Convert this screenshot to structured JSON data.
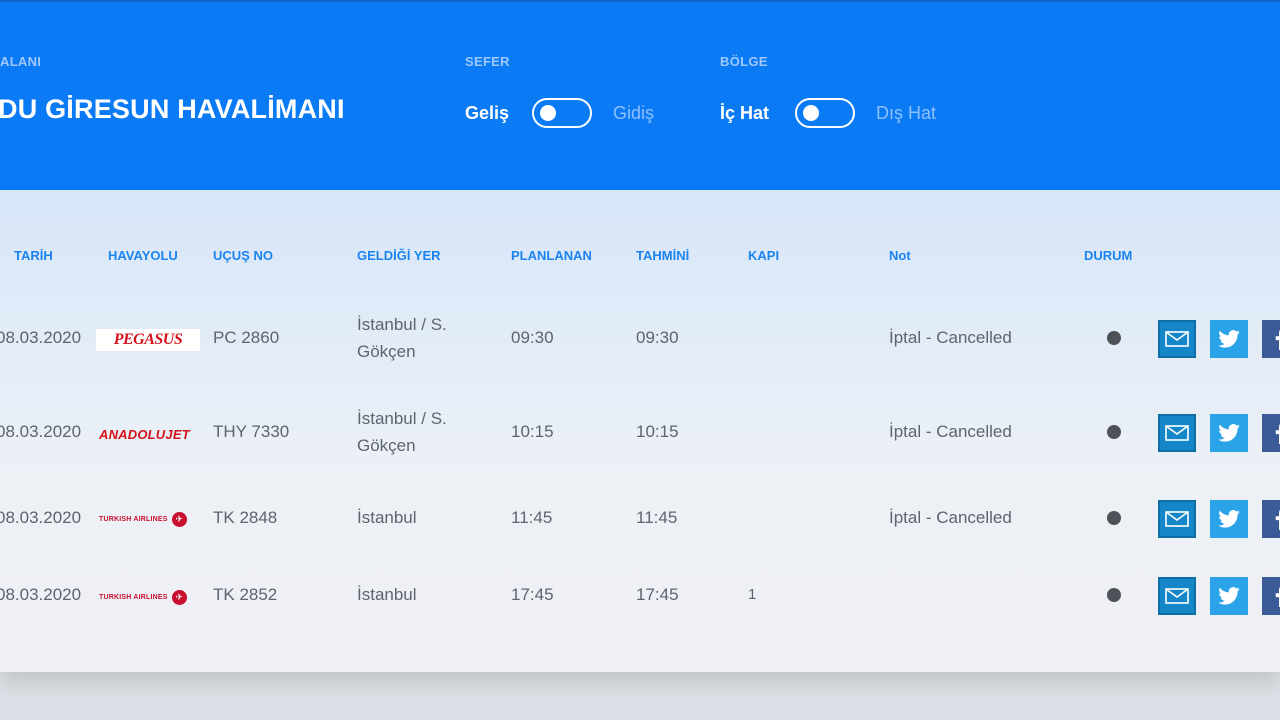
{
  "header": {
    "airport_label": "ALANI",
    "airport_name": "DU GİRESUN HAVALİMANI",
    "sefer_label": "SEFER",
    "sefer_on": "Geliş",
    "sefer_off": "Gidiş",
    "bolge_label": "BÖLGE",
    "bolge_on": "İç Hat",
    "bolge_off": "Dış Hat"
  },
  "table": {
    "columns": {
      "tarih": "TARİH",
      "havayolu": "HAVAYOLU",
      "ucus_no": "UÇUŞ NO",
      "geldigi_yer": "GELDİĞİ YER",
      "planlanan": "PLANLANAN",
      "tahmini": "TAHMİNİ",
      "kapi": "KAPI",
      "not": "Not",
      "durum": "DURUM"
    },
    "rows": [
      {
        "date": "08.03.2020",
        "airline_logo_text": "PEGASUS",
        "flight": "PC 2860",
        "origin_line1": "İstanbul / S.",
        "origin_line2": "Gökçen",
        "planned": "09:30",
        "estimated": "09:30",
        "gate": "",
        "note": "İptal - Cancelled"
      },
      {
        "date": "08.03.2020",
        "airline_logo_text": "ANADOLUJET",
        "flight": "THY 7330",
        "origin_line1": "İstanbul / S.",
        "origin_line2": "Gökçen",
        "planned": "10:15",
        "estimated": "10:15",
        "gate": "",
        "note": "İptal - Cancelled"
      },
      {
        "date": "08.03.2020",
        "airline_logo_text": "TURKISH AIRLINES",
        "flight": "TK 2848",
        "origin_line1": "İstanbul",
        "origin_line2": "",
        "planned": "11:45",
        "estimated": "11:45",
        "gate": "",
        "note": "İptal - Cancelled"
      },
      {
        "date": "08.03.2020",
        "airline_logo_text": "TURKISH AIRLINES",
        "flight": "TK 2852",
        "origin_line1": "İstanbul",
        "origin_line2": "",
        "planned": "17:45",
        "estimated": "17:45",
        "gate": "1",
        "note": ""
      }
    ]
  },
  "icons": {
    "share_mail": "mail-icon",
    "share_twitter": "twitter-icon",
    "share_facebook": "facebook-icon",
    "status": "status-dot-icon"
  },
  "colors": {
    "header_bg": "#0b7af5",
    "accent": "#1b84f0",
    "cancel_text": "#5d6470"
  }
}
